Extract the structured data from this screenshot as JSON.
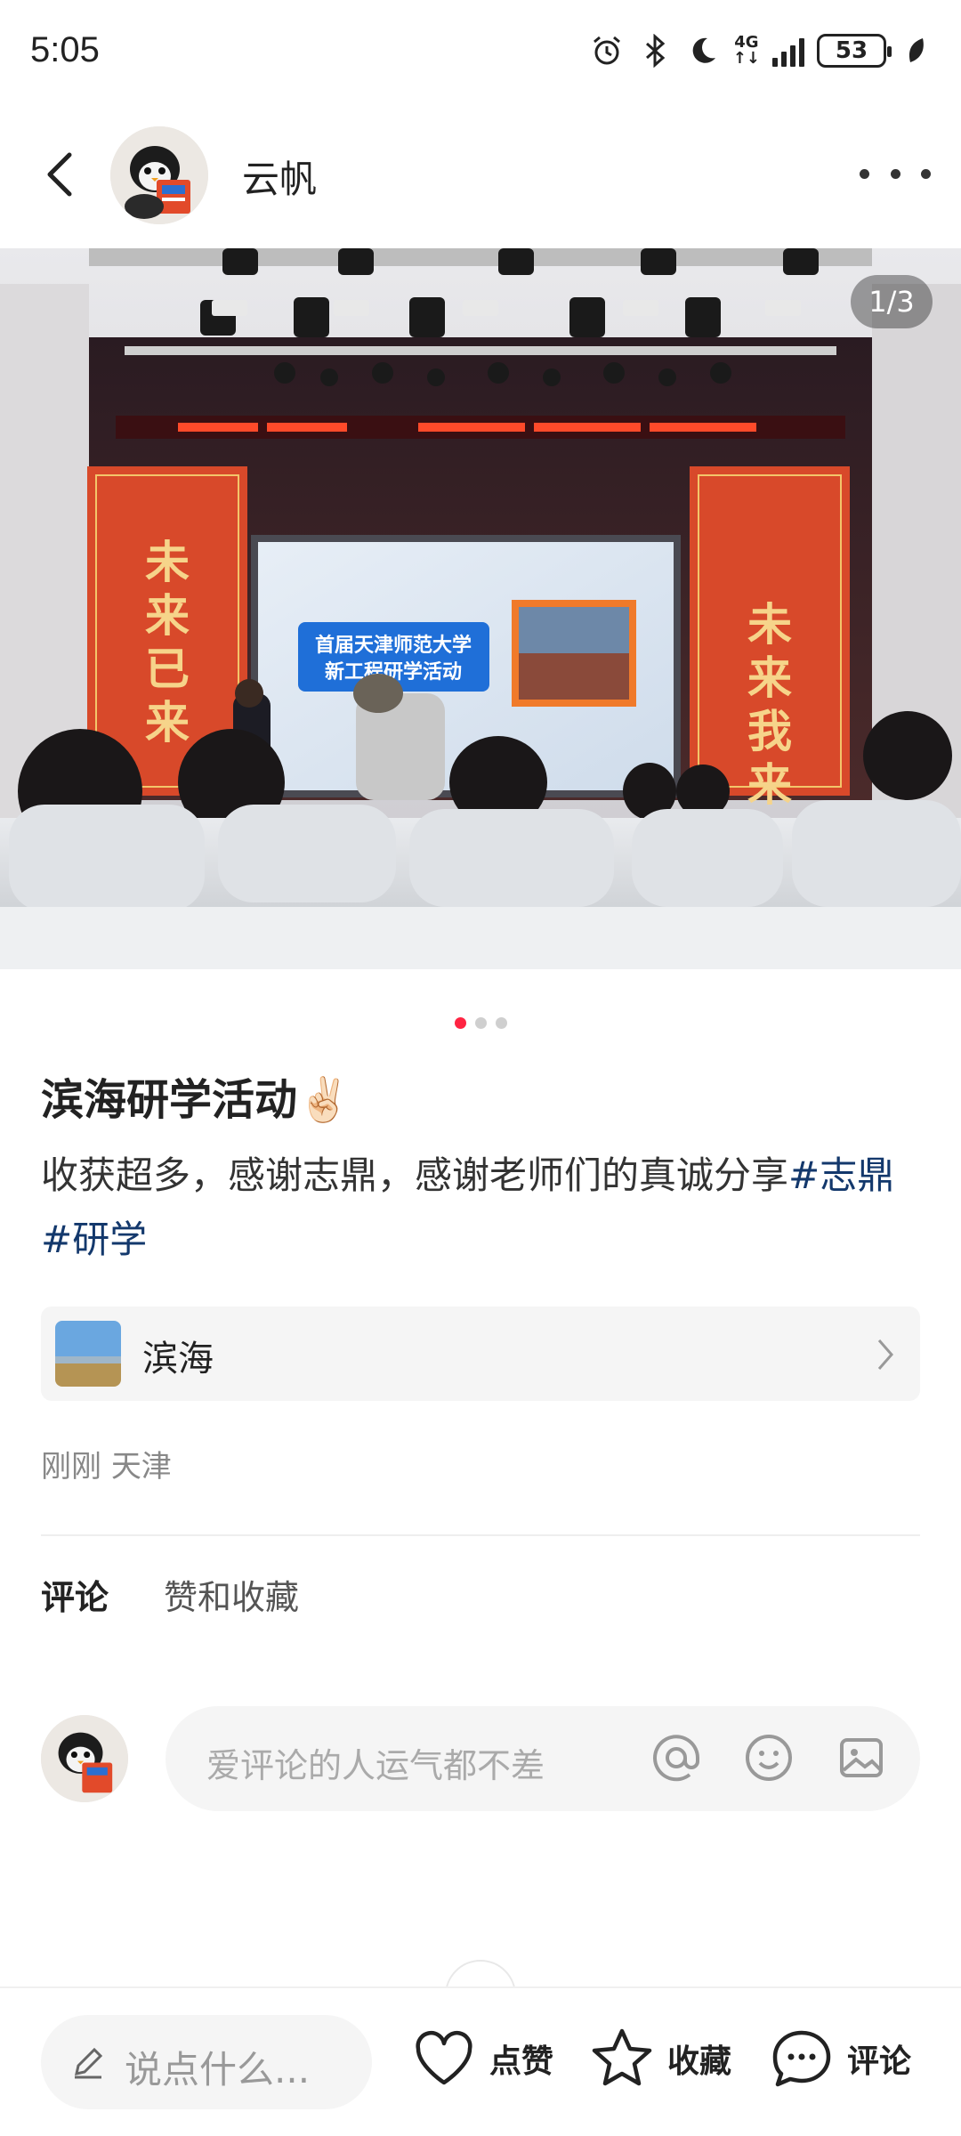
{
  "status_bar": {
    "time": "5:05",
    "network": "4G",
    "battery": "53",
    "icons": [
      "alarm-icon",
      "bluetooth-icon",
      "moon-icon",
      "signal-icon",
      "battery-icon",
      "leaf-icon"
    ]
  },
  "header": {
    "author": "云帆",
    "icons": [
      "back-arrow-icon",
      "more-icon"
    ]
  },
  "gallery": {
    "page_indicator": "1/3",
    "current": 1,
    "total": 3
  },
  "photo_scene": {
    "banner_left": "未来已来",
    "banner_right": "未来我来",
    "screen_title_line1": "首届天津师范大学",
    "screen_title_line2": "新工程研学活动"
  },
  "post": {
    "title": "滨海研学活动✌🏻",
    "body": "收获超多，感谢志鼎，感谢老师们的真诚分享",
    "tags": [
      "#志鼎",
      "#研学"
    ],
    "location": "滨海",
    "time": "刚刚",
    "region": "天津"
  },
  "tabs": [
    "评论",
    "赞和收藏"
  ],
  "comment_input": {
    "placeholder": "爱评论的人运气都不差",
    "icons": [
      "at-icon",
      "emoji-icon",
      "image-icon"
    ]
  },
  "bottom_bar": {
    "say_placeholder": "说点什么...",
    "like_label": "点赞",
    "collect_label": "收藏",
    "comment_label": "评论"
  },
  "colors": {
    "accent": "#ff2442",
    "tag": "#13386c",
    "placeholder": "#aaaaaa"
  }
}
